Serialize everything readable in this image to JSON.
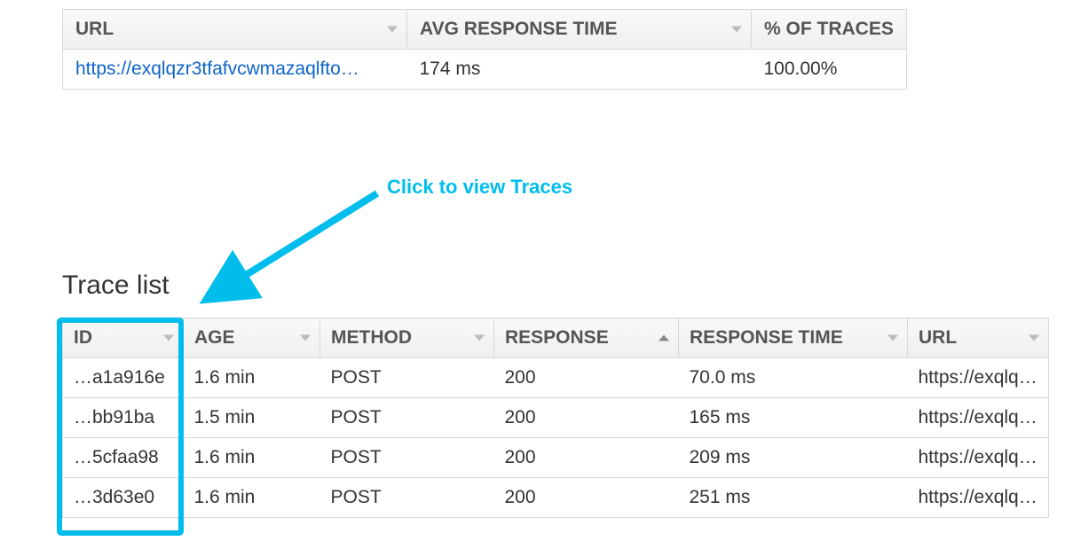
{
  "summary": {
    "headers": {
      "url": "URL",
      "avg": "AVG RESPONSE TIME",
      "pct": "% OF TRACES"
    },
    "row": {
      "url": "https://exqlqzr3tfafvcwmazaqlfto…",
      "avg": "174 ms",
      "pct": "100.00%"
    }
  },
  "trace_heading": "Trace list",
  "annotation_text": "Click to view Traces",
  "trace_headers": {
    "id": "ID",
    "age": "AGE",
    "method": "METHOD",
    "response": "RESPONSE",
    "rt": "RESPONSE TIME",
    "url": "URL"
  },
  "traces": [
    {
      "id": "…a1a916e",
      "age": "1.6 min",
      "method": "POST",
      "response": "200",
      "rt": "70.0 ms",
      "url": "https://exqlq…"
    },
    {
      "id": "…bb91ba",
      "age": "1.5 min",
      "method": "POST",
      "response": "200",
      "rt": "165 ms",
      "url": "https://exqlq…"
    },
    {
      "id": "…5cfaa98",
      "age": "1.6 min",
      "method": "POST",
      "response": "200",
      "rt": "209 ms",
      "url": "https://exqlq…"
    },
    {
      "id": "…3d63e0",
      "age": "1.6 min",
      "method": "POST",
      "response": "200",
      "rt": "251 ms",
      "url": "https://exqlq…"
    }
  ]
}
